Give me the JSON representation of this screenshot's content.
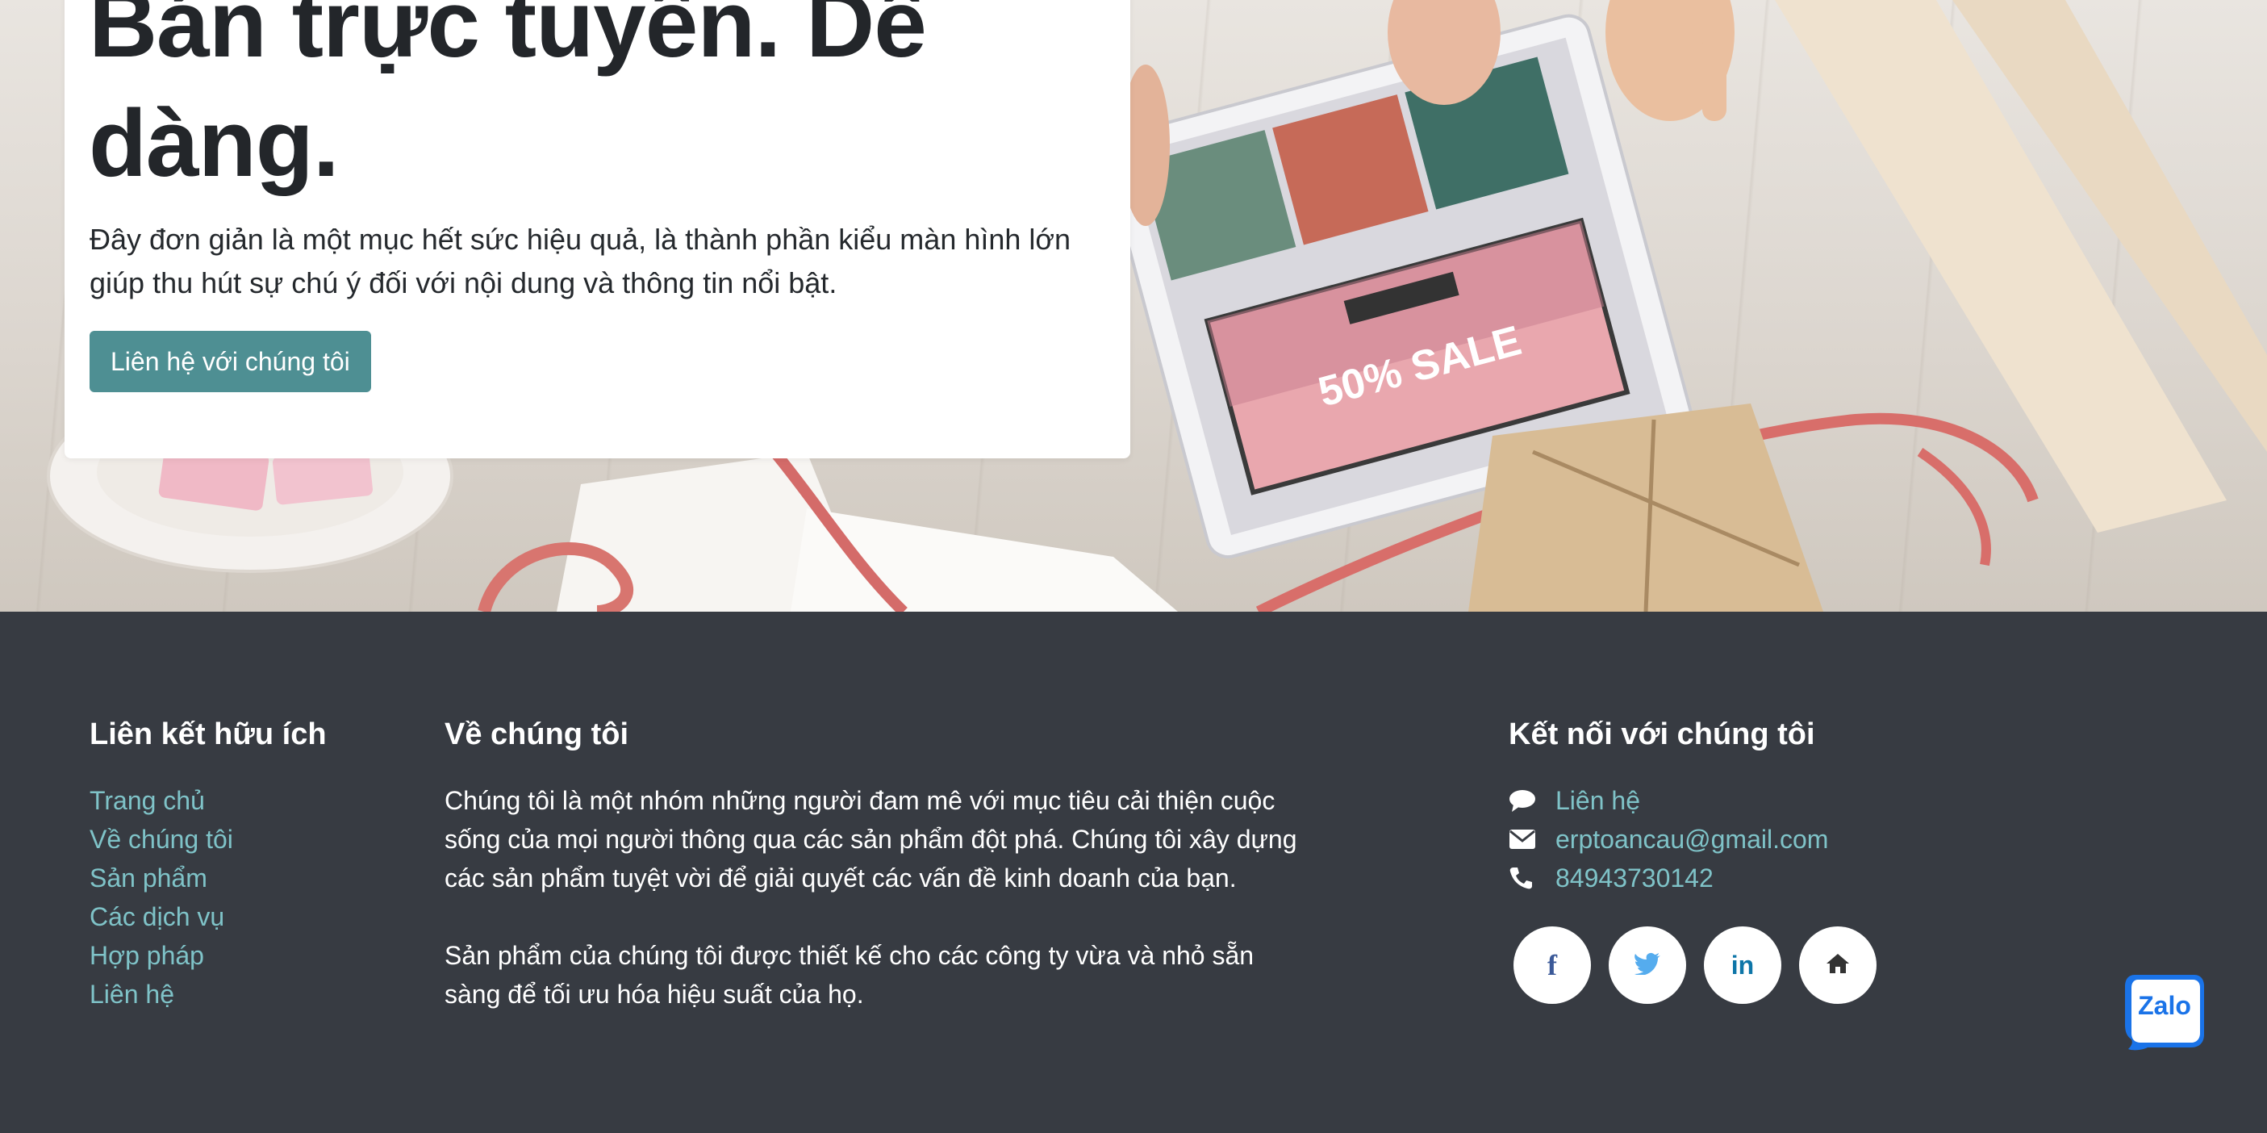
{
  "hero": {
    "title": "Bán trực tuyến. Dễ dàng.",
    "description": "Đây đơn giản là một mục hết sức hiệu quả, là thành phần kiểu màn hình lớn giúp thu hút sự chú ý đối với nội dung và thông tin nổi bật.",
    "cta_label": "Liên hệ với chúng tôi",
    "image_text": {
      "sale": "50% SALE"
    }
  },
  "footer": {
    "links_title": "Liên kết hữu ích",
    "links": [
      "Trang chủ",
      "Về chúng tôi",
      "Sản phẩm",
      "Các dịch vụ",
      "Hợp pháp",
      "Liên hệ"
    ],
    "about_title": "Về chúng tôi",
    "about_p1": "Chúng tôi là một nhóm những người đam mê với mục tiêu cải thiện cuộc sống của mọi người thông qua các sản phẩm đột phá. Chúng tôi xây dựng các sản phẩm tuyệt vời để giải quyết các vấn đề kinh doanh của bạn.",
    "about_p2": "Sản phẩm của chúng tôi được thiết kế cho các công ty vừa và nhỏ sẵn sàng để tối ưu hóa hiệu suất của họ.",
    "connect_title": "Kết nối với chúng tôi",
    "contact": {
      "chat": "Liên hệ",
      "email": "erptoancau@gmail.com",
      "phone": "84943730142"
    },
    "socials": [
      {
        "icon": "facebook-icon",
        "glyph": "f",
        "color": "#3b5998"
      },
      {
        "icon": "twitter-icon",
        "glyph": "t",
        "color": "#55acee"
      },
      {
        "icon": "linkedin-icon",
        "glyph": "in",
        "color": "#0e76a8"
      },
      {
        "icon": "home-icon",
        "glyph": "⌂",
        "color": "#333333"
      }
    ]
  },
  "zalo": {
    "label": "Zalo"
  },
  "colors": {
    "accent": "#4e8f93",
    "link": "#7fc3c8",
    "footer_bg": "#373b42"
  }
}
